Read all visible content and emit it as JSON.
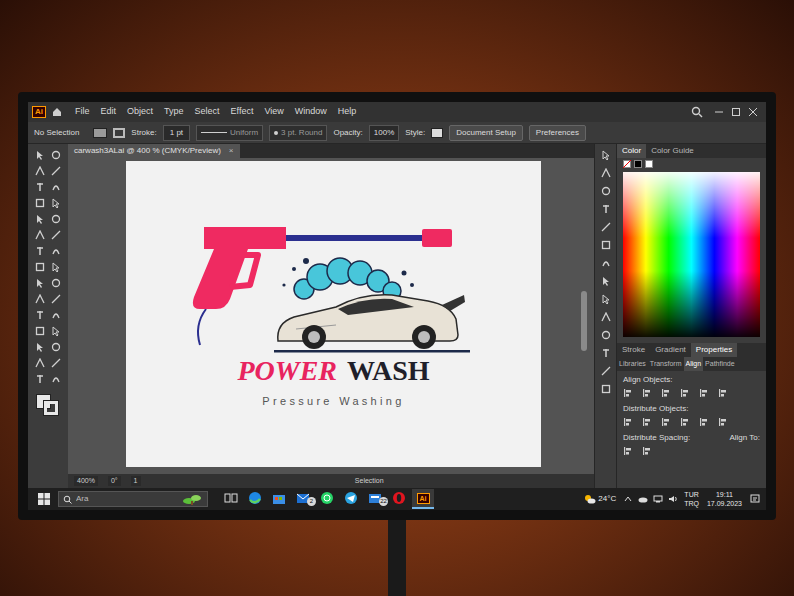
{
  "app": {
    "logo": "Ai",
    "menu": [
      "File",
      "Edit",
      "Object",
      "Type",
      "Select",
      "Effect",
      "View",
      "Window",
      "Help"
    ]
  },
  "control_bar": {
    "selection": "No Selection",
    "stroke_label": "Stroke:",
    "stroke_value": "1 pt",
    "profile": "Uniform",
    "brush": "3 pt. Round",
    "opacity_label": "Opacity:",
    "opacity_value": "100%",
    "style_label": "Style:",
    "buttons": [
      "Document Setup",
      "Preferences"
    ]
  },
  "document_tab": {
    "title": "carwash3ALai @ 400 % (CMYK/Preview)",
    "close": "×"
  },
  "artwork": {
    "title_1": "POWER",
    "title_2": "WASH",
    "subtitle": "Pressure Washing"
  },
  "color_panel": {
    "tabs": [
      {
        "label": "Color",
        "selected": true
      },
      {
        "label": "Color Guide",
        "selected": false
      }
    ]
  },
  "properties_panel": {
    "tabs": [
      {
        "label": "Stroke",
        "selected": false
      },
      {
        "label": "Gradient",
        "selected": false
      },
      {
        "label": "Properties",
        "selected": true
      }
    ],
    "sub_tabs": [
      {
        "label": "Libraries",
        "selected": false
      },
      {
        "label": "Transform",
        "selected": false
      },
      {
        "label": "Align",
        "selected": true
      },
      {
        "label": "Pathfinde",
        "selected": false
      }
    ],
    "sections": [
      "Align Objects:",
      "Distribute Objects:",
      "Distribute Spacing:"
    ],
    "align_to": "Align To:"
  },
  "status_bar": {
    "zoom": "400%",
    "rotation": "0°",
    "artboard": "1",
    "tool": "Selection"
  },
  "taskbar": {
    "search": {
      "placeholder": "Ara"
    },
    "apps": [
      {
        "kind": "taskview",
        "active": false
      },
      {
        "kind": "edge",
        "active": false
      },
      {
        "kind": "store",
        "active": false
      },
      {
        "kind": "mail",
        "active": false,
        "badge": "2"
      },
      {
        "kind": "whatsapp",
        "active": false
      },
      {
        "kind": "telegram",
        "active": false
      },
      {
        "kind": "files",
        "active": false,
        "badge": "22"
      },
      {
        "kind": "opera",
        "active": false
      },
      {
        "kind": "illustrator",
        "active": true,
        "label": "Ai"
      }
    ],
    "weather": "24°C",
    "language": [
      "TUR",
      "TRQ"
    ],
    "time": "19:11",
    "date": "17.09.2023"
  }
}
